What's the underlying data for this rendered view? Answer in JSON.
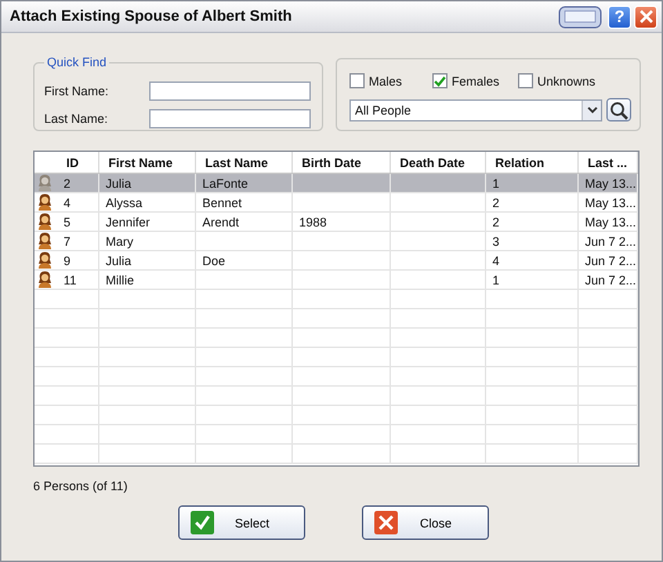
{
  "window": {
    "title": "Attach Existing Spouse of Albert Smith",
    "help_button": "?"
  },
  "quick_find": {
    "legend": "Quick Find",
    "fields": [
      {
        "label": "First Name:"
      },
      {
        "label": "Last Name:"
      }
    ]
  },
  "filters": [
    {
      "label": "Males",
      "checked": false
    },
    {
      "label": "Females",
      "checked": true
    },
    {
      "label": "Unknowns",
      "checked": false
    }
  ],
  "scope_dropdown": {
    "value": "All People"
  },
  "table": {
    "columns": [
      "ID",
      "First Name",
      "Last Name",
      "Birth Date",
      "Death Date",
      "Relation",
      "Last ..."
    ],
    "rows": [
      {
        "selected": true,
        "cells": [
          "2",
          "Julia",
          "LaFonte",
          "",
          "",
          "1",
          "May 13..."
        ]
      },
      {
        "selected": false,
        "cells": [
          "4",
          "Alyssa",
          "Bennet",
          "",
          "",
          "2",
          "May 13..."
        ]
      },
      {
        "selected": false,
        "cells": [
          "5",
          "Jennifer",
          "Arendt",
          "1988",
          "",
          "2",
          "May 13..."
        ]
      },
      {
        "selected": false,
        "cells": [
          "7",
          "Mary",
          "",
          "",
          "",
          "3",
          "Jun 7 2..."
        ]
      },
      {
        "selected": false,
        "cells": [
          "9",
          "Julia",
          "Doe",
          "",
          "",
          "4",
          "Jun 7 2..."
        ]
      },
      {
        "selected": false,
        "cells": [
          "11",
          "Millie",
          "",
          "",
          "",
          "1",
          "Jun 7 2..."
        ]
      }
    ]
  },
  "status": "6 Persons (of 11)",
  "buttons": [
    {
      "label": "Select",
      "kind": "ok"
    },
    {
      "label": "Close",
      "kind": "cancel"
    }
  ]
}
